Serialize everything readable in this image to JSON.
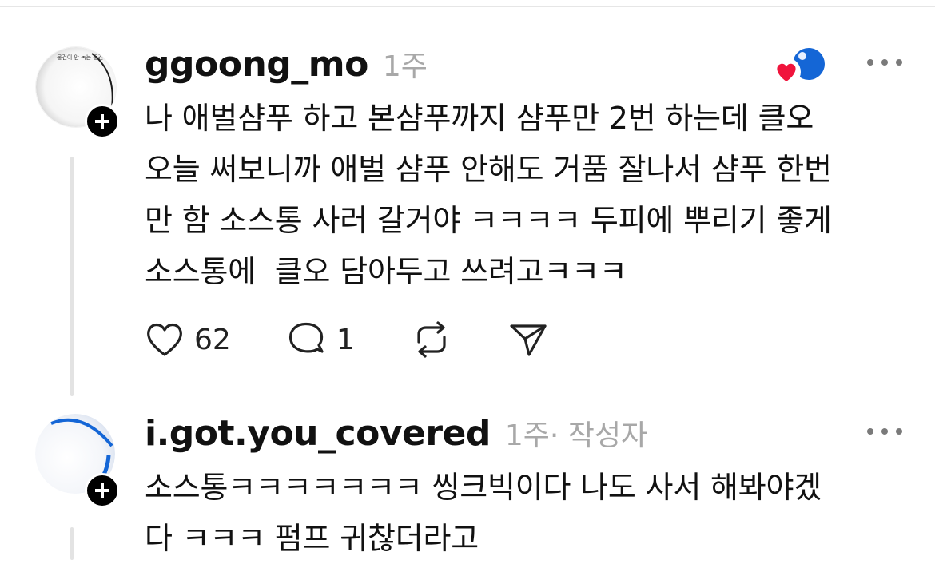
{
  "comments": [
    {
      "username": "ggoong_mo",
      "time": "1주",
      "author_tag": "",
      "avatar_caption": "물건이 안 녹는 물건이",
      "text": "나 애벌샴푸 하고 본샴푸까지 샴푸만 2번 하는데 클오\n오늘 써보니까 애벌 샴푸 안해도 거품 잘나서 샴푸 한번\n만 함 소스통 사러 갈거야 ㅋㅋㅋㅋ 두피에 뿌리기 좋게\n소스통에  클오 담아두고 쓰려고ㅋㅋㅋ",
      "actions": {
        "likes": "62",
        "replies": "1"
      },
      "reaction_icons": [
        "heart-icon",
        "blue-avatar-icon"
      ]
    },
    {
      "username": "i.got.you_covered",
      "time": "1주",
      "author_tag": " · 작성자",
      "text": "소스통ㅋㅋㅋㅋㅋㅋㅋ 씽크빅이다 나도 사서 해봐야겠\n다 ㅋㅋㅋ 펌프 귀찮더라고"
    }
  ],
  "colors": {
    "text": "#111111",
    "muted": "#a8a8a8",
    "heart": "#f0143c",
    "blue": "#1466d6"
  }
}
